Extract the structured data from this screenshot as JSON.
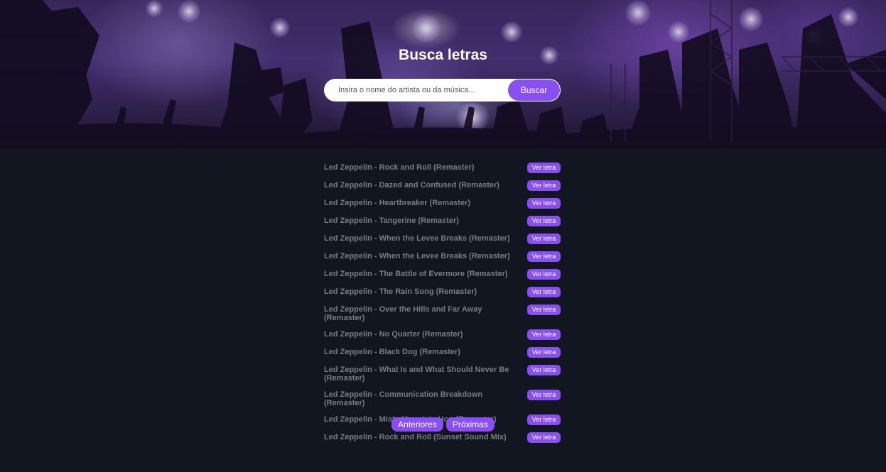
{
  "header": {
    "title": "Busca letras",
    "search_placeholder": "Insira o nome do artista ou da música...",
    "search_button_label": "Buscar"
  },
  "results": [
    {
      "title": "Led Zeppelin - Rock and Roll (Remaster)",
      "button_label": "Ver letra"
    },
    {
      "title": "Led Zeppelin - Dazed and Confused (Remaster)",
      "button_label": "Ver letra"
    },
    {
      "title": "Led Zeppelin - Heartbreaker (Remaster)",
      "button_label": "Ver letra"
    },
    {
      "title": "Led Zeppelin - Tangerine (Remaster)",
      "button_label": "Ver letra"
    },
    {
      "title": "Led Zeppelin - When the Levee Breaks (Remaster)",
      "button_label": "Ver letra"
    },
    {
      "title": "Led Zeppelin - When the Levee Breaks (Remaster)",
      "button_label": "Ver letra"
    },
    {
      "title": "Led Zeppelin - The Battle of Evermore (Remaster)",
      "button_label": "Ver letra"
    },
    {
      "title": "Led Zeppelin - The Rain Song (Remaster)",
      "button_label": "Ver letra"
    },
    {
      "title": "Led Zeppelin - Over the Hills and Far Away (Remaster)",
      "button_label": "Ver letra"
    },
    {
      "title": "Led Zeppelin - No Quarter (Remaster)",
      "button_label": "Ver letra"
    },
    {
      "title": "Led Zeppelin - Black Dog (Remaster)",
      "button_label": "Ver letra"
    },
    {
      "title": "Led Zeppelin - What Is and What Should Never Be (Remaster)",
      "button_label": "Ver letra"
    },
    {
      "title": "Led Zeppelin - Communication Breakdown (Remaster)",
      "button_label": "Ver letra"
    },
    {
      "title": "Led Zeppelin - Misty Mountain Hop (Remaster)",
      "button_label": "Ver letra"
    },
    {
      "title": "Led Zeppelin - Rock and Roll (Sunset Sound Mix)",
      "button_label": "Ver letra"
    }
  ],
  "pagination": {
    "previous_label": "Anteriores",
    "next_label": "Próximas"
  },
  "colors": {
    "accent": "#8a4ff0",
    "page_background": "#111620",
    "result_text": "#797c82"
  }
}
